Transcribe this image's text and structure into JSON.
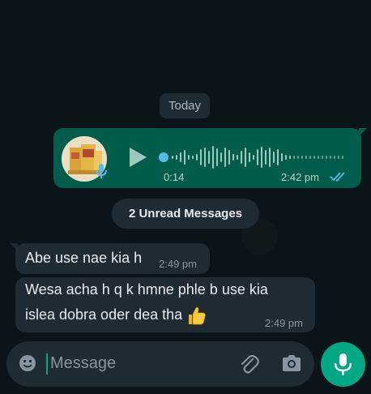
{
  "chat": {
    "date_chip": "Today",
    "voice_message": {
      "duration": "0:14",
      "time": "2:42 pm",
      "status": "read",
      "accent_color": "#005c4b"
    },
    "unread_divider": "2 Unread Messages",
    "messages": [
      {
        "lines": [
          "Abe use nae kia h"
        ],
        "time": "2:49 pm"
      },
      {
        "lines": [
          "Wesa acha h q k hmne phle b use kia",
          "islea dobra oder dea tha"
        ],
        "emoji": "thumbs-up-emoji",
        "time": "2:49 pm"
      }
    ]
  },
  "composer": {
    "placeholder": "Message",
    "icons": [
      "emoji-icon",
      "attach-icon",
      "camera-icon",
      "mic-icon"
    ],
    "accent_color": "#00a884"
  }
}
